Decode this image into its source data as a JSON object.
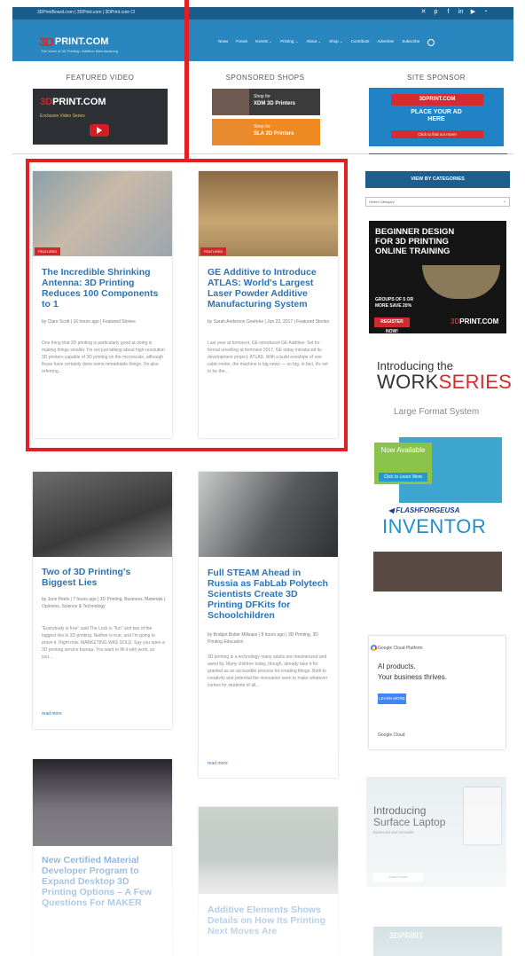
{
  "topbar": {
    "links": "3DPrintBoard.com  |  3DPrint.com  |  3DPrint.com Cl",
    "social_icons": [
      "twitter-icon",
      "pinterest-icon",
      "facebook-icon",
      "linkedin-icon",
      "youtube-icon",
      "rss-icon"
    ]
  },
  "header": {
    "logo_prefix": "3D",
    "logo_text": "PRINT.COM",
    "logo_tagline": "The Voice of 3D Printing / Additive Manufacturing",
    "menu": [
      "News",
      "Forum",
      "Events ⌄",
      "Printing ⌄",
      "About ⌄",
      "Shop ⌄",
      "Contribute",
      "Advertise",
      "Subscribe"
    ]
  },
  "top_sections": {
    "featured_video": {
      "heading": "FEATURED VIDEO",
      "brand_prefix": "3D",
      "brand_text": "PRINT.COM",
      "subtitle": "Exclusive Video Series"
    },
    "sponsored_shops": {
      "heading": "SPONSORED SHOPS",
      "shops": [
        {
          "line1": "Shop for",
          "line2": "XDM 3D Printers"
        },
        {
          "line1": "Shop for",
          "line2": "SLA 3D Printers"
        }
      ]
    },
    "site_sponsor": {
      "heading": "SITE SPONSOR",
      "banner": "3DPRINT.COM",
      "text": "PLACE YOUR AD HERE",
      "cta": "Click to find out more!"
    }
  },
  "articles": [
    {
      "badge": "FEATURED",
      "title": "The Incredible Shrinking Antenna: 3D Printing Reduces 100 Components to 1",
      "meta": "by Clare Scott | 16 hours ago | Featured Stories",
      "excerpt": "One thing that 3D printing is particularly good at doing is making things smaller. I'm not just talking about high-resolution 3D printers capable of 3D printing on the microscale, although those have certainly done some remarkable things. I'm also referring..."
    },
    {
      "badge": "FEATURED",
      "title": "GE Additive to Introduce ATLAS: World's Largest Laser Powder Additive Manufacturing System",
      "meta": "by Sarah Anderson Goehrke | Jun 23, 2017 | Featured Stories",
      "excerpt": "Last year at formnext, GE introduced GE Additive. Set for formal unveiling at formnext 2017, GE today introduced its development project, ATLAS. With a build envelope of one cubic meter, the machine is big news — so big, in fact, it's set to be the..."
    },
    {
      "title": "Two of 3D Printing's Biggest Lies",
      "meta": "by Joris Peels | 7 hours ago | 3D Printing, Business, Materials | Opinions, Science & Technology",
      "excerpt": "\"Everybody is free\" said The Lock is \"fun\" and two of the biggest lies in 3D printing. Neither is true, and I'm going to prove it. Right now. MARKETING WAS SOLD. Say you open a 3D printing service bureau. You want to fill it with work, so you...",
      "more": "read more"
    },
    {
      "title": "Full STEAM Ahead in Russia as FabLab Polytech Scientists Create 3D Printing DFKits for Schoolchildren",
      "meta": "by Bridget Butler Millsaps | 8 hours ago | 3D Printing, 3D Printing Education",
      "excerpt": "3D printing is a technology many adults are mesmerized and awed by. Many children today, though, already take it for granted as an accessible process for creating things. Both to creativity and potential the innovation seen to make whatever comes for students of all...",
      "more": "read more"
    },
    {
      "title": "New Certified Material Developer Program to Expand Desktop 3D Printing Options – A Few Questions For MAKER"
    },
    {
      "title": "Additive Elements Shows Details on How Its Printing Next Moves Are"
    }
  ],
  "sidebar": {
    "categories_heading": "VIEW BY CATEGORIES",
    "categories_select": "Select Category",
    "ad_training": {
      "lines": [
        "BEGINNER DESIGN",
        "FOR 3D PRINTING",
        "ONLINE TRAINING"
      ],
      "group": "GROUPS OF 5 OR MORE SAVE 20%",
      "cta": "REGISTER NOW!",
      "brand_prefix": "3D",
      "brand_text": "PRINT.COM"
    },
    "workseries": {
      "intro": "Introducing the",
      "work": "WORK",
      "series": "SERIES",
      "tagline": "Large Format System"
    },
    "flashforge": {
      "now": "Now Available",
      "cta": "Click to Learn More",
      "brand": "◀ FLASHFORGEUSA",
      "product": "INVENTOR"
    },
    "google_cloud": {
      "header": "Google Cloud Platform",
      "line1": "AI products.",
      "line2": "Your business thrives.",
      "button": "LEARN MORE",
      "footer": "Google Cloud"
    },
    "surface": {
      "title": "Introducing Surface Laptop",
      "subtitle": "Balanced and versatile",
      "button": "Learn more"
    },
    "bottom_ad": "3DPRINT"
  },
  "colors": {
    "brand_blue": "#2a86bf",
    "nav_dark": "#1b5d8a",
    "accent_red": "#d5252b",
    "link_blue": "#2b73b7",
    "callout_red": "#e31e24"
  }
}
